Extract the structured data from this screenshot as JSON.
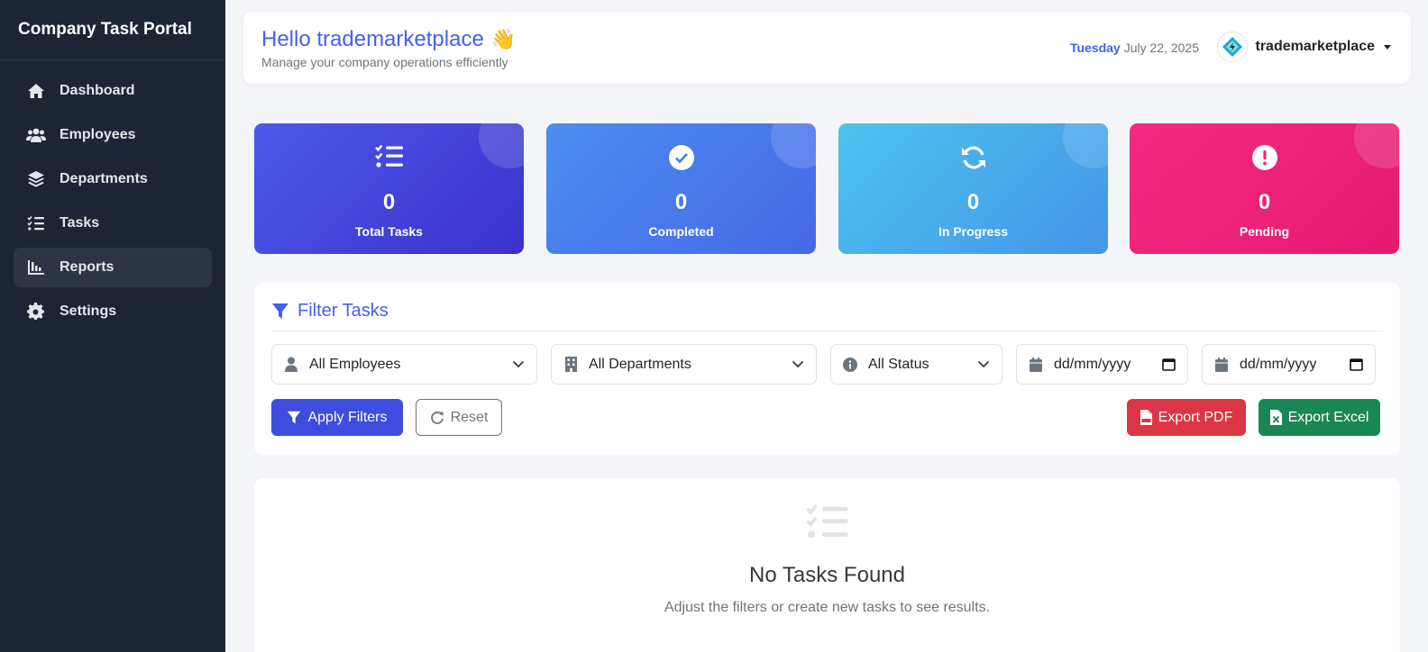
{
  "sidebar": {
    "brand": "Company Task Portal",
    "items": [
      {
        "label": "Dashboard",
        "icon": "home-icon"
      },
      {
        "label": "Employees",
        "icon": "users-icon"
      },
      {
        "label": "Departments",
        "icon": "layers-icon"
      },
      {
        "label": "Tasks",
        "icon": "tasks-icon"
      },
      {
        "label": "Reports",
        "icon": "chart-bar-icon",
        "active": true
      },
      {
        "label": "Settings",
        "icon": "gear-icon"
      }
    ]
  },
  "header": {
    "greeting": "Hello trademarketplace",
    "wave": "👋",
    "subtitle": "Manage your company operations efficiently",
    "weekday": "Tuesday",
    "date": "July 22, 2025",
    "username": "trademarketplace"
  },
  "stats": [
    {
      "value": "0",
      "label": "Total Tasks",
      "icon": "tasks-icon"
    },
    {
      "value": "0",
      "label": "Completed",
      "icon": "check-circle-icon"
    },
    {
      "value": "0",
      "label": "In Progress",
      "icon": "sync-icon"
    },
    {
      "value": "0",
      "label": "Pending",
      "icon": "exclamation-circle-icon"
    }
  ],
  "filters": {
    "title": "Filter Tasks",
    "employee": "All Employees",
    "department": "All Departments",
    "status": "All Status",
    "date_from": "dd/mm/yyyy",
    "date_to": "dd/mm/yyyy",
    "apply_label": "Apply Filters",
    "reset_label": "Reset",
    "export_pdf_label": "Export PDF",
    "export_excel_label": "Export Excel"
  },
  "empty_state": {
    "title": "No Tasks Found",
    "description": "Adjust the filters or create new tasks to see results."
  },
  "colors": {
    "sidebar_bg": "#1d2434",
    "accent": "#4361ee",
    "pdf": "#dc3545",
    "excel": "#198754",
    "pending": "#f22a82"
  }
}
